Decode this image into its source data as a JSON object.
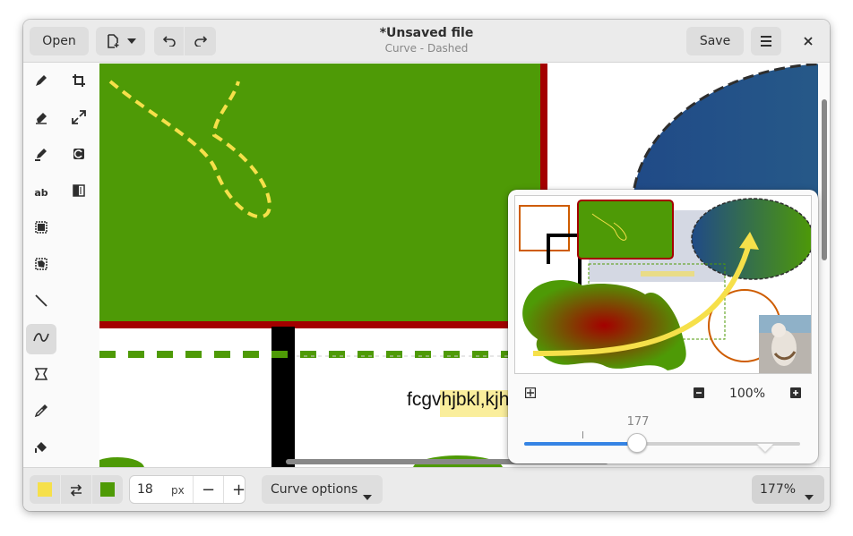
{
  "window": {
    "title": "*Unsaved file",
    "subtitle": "Curve - Dashed"
  },
  "header": {
    "open_label": "Open",
    "save_label": "Save",
    "new_icon": "new-document-icon",
    "undo_icon": "undo-icon",
    "redo_icon": "redo-icon",
    "menu_icon": "hamburger-menu-icon",
    "close_icon": "close-icon"
  },
  "tools": [
    {
      "name": "pencil",
      "icon": "pencil-icon"
    },
    {
      "name": "crop",
      "icon": "crop-icon"
    },
    {
      "name": "eraser",
      "icon": "eraser-icon"
    },
    {
      "name": "scale",
      "icon": "scale-icon"
    },
    {
      "name": "highlighter",
      "icon": "highlighter-icon"
    },
    {
      "name": "rotate",
      "icon": "rotate-icon"
    },
    {
      "name": "text",
      "icon": "text-icon",
      "label": "ab"
    },
    {
      "name": "filters",
      "icon": "filters-icon"
    },
    {
      "name": "rect-select",
      "icon": "rect-select-icon"
    },
    {
      "name": "free-select",
      "icon": "free-select-icon"
    },
    {
      "name": "line",
      "icon": "line-icon"
    },
    {
      "name": "curve",
      "icon": "curve-icon",
      "active": true
    },
    {
      "name": "shape",
      "icon": "shape-icon"
    },
    {
      "name": "color-picker",
      "icon": "color-picker-icon"
    },
    {
      "name": "paint",
      "icon": "paint-bucket-icon"
    }
  ],
  "canvas": {
    "text": "fcgvhjbkl,kjhv"
  },
  "bottom": {
    "left_color": "#f6e04a",
    "right_color": "#4e9a06",
    "swap_icon": "swap-colors-icon",
    "size_value": "18",
    "size_unit": "px",
    "minus_label": "−",
    "plus_label": "+",
    "options_label": "Curve options",
    "zoom_label": "177%"
  },
  "popover": {
    "zoom_percent": "100%",
    "slider_value": "177",
    "slider_fraction": 0.41,
    "optimal_zoom_icon": "zoom-fit-icon",
    "zoom_out_icon": "zoom-out-icon",
    "zoom_in_icon": "zoom-in-icon"
  },
  "colors": {
    "green": "#4e9a06",
    "red": "#a40000",
    "yellow": "#f6e04a",
    "blue": "#204a87",
    "accent": "#3584e4"
  }
}
